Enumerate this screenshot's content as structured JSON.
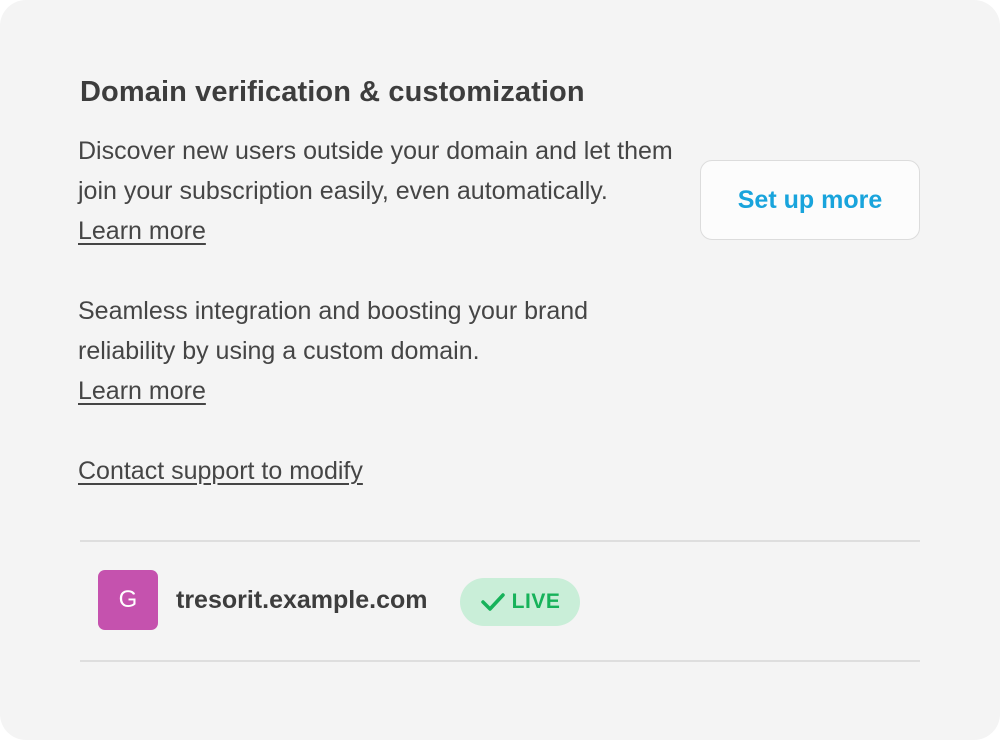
{
  "section": {
    "title": "Domain verification & customization",
    "description_1": "Discover new users outside your domain and let them join your subscription easily, even automatically.",
    "learn_more_1": "Learn more",
    "description_2": "Seamless integration and boosting your brand reliability by using a custom domain.",
    "learn_more_2": "Learn more",
    "contact_link": "Contact support to modify",
    "setup_button": "Set up more"
  },
  "domain": {
    "avatar_letter": "G",
    "name": "tresorit.example.com",
    "status": "LIVE",
    "status_icon": "check-icon"
  },
  "colors": {
    "accent": "#19a4dc",
    "avatar": "#c552ae",
    "live_bg": "#c9eed8",
    "live_text": "#16b25a"
  }
}
